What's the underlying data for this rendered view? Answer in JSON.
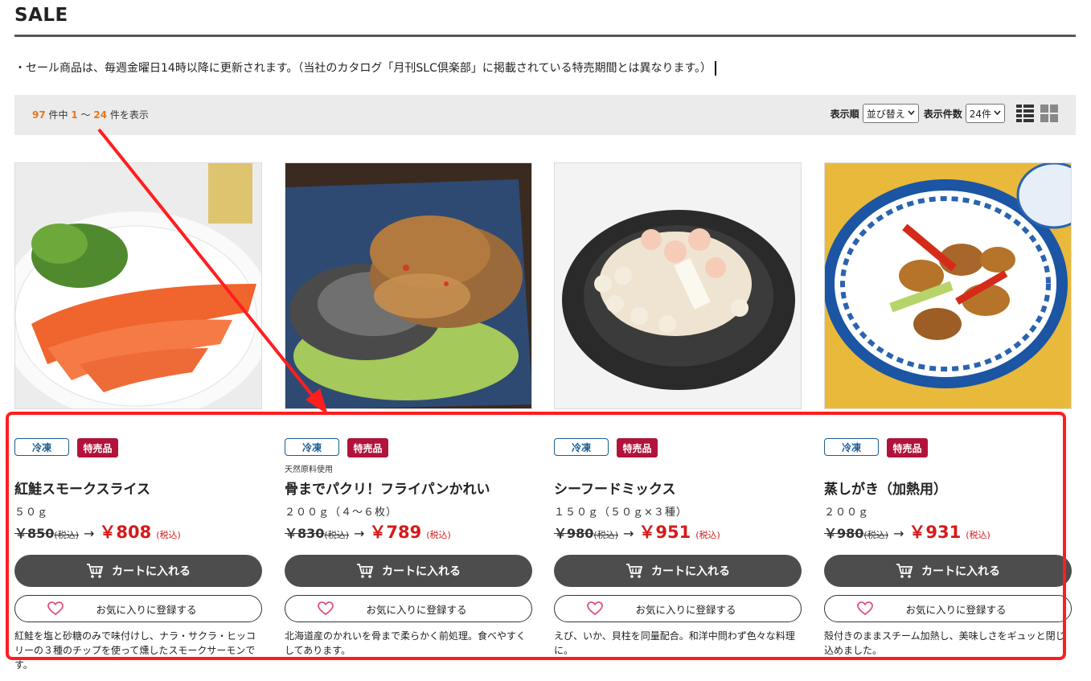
{
  "page": {
    "title": "SALE",
    "notice": "・セール商品は、毎週金曜日14時以降に更新されます。（当社のカタログ「月刊SLC倶楽部」に掲載されている特売期間とは異なります。）"
  },
  "toolbar": {
    "total": "97",
    "count_mid1": " 件中 ",
    "from": "1",
    "tilde": " ～ ",
    "to": "24",
    "count_tail": " 件を表示",
    "sort_label": "表示順",
    "sort_value": "並び替え",
    "perpage_label": "表示件数",
    "perpage_value": "24件"
  },
  "products": [
    {
      "badge_frozen": "冷凍",
      "badge_sale": "特売品",
      "tag": "",
      "name": "紅鮭スモークスライス",
      "spec": "５０ｇ",
      "old_price": "￥850",
      "old_tax": "(税込)",
      "arrow": "→",
      "new_price": "￥808",
      "new_tax": "(税込)",
      "cart_label": "カートに入れる",
      "fav_label": "お気に入りに登録する",
      "description": "紅鮭を塩と砂糖のみで味付けし、ナラ・サクラ・ヒッコリーの３種のチップを使って燻したスモークサーモンです。"
    },
    {
      "badge_frozen": "冷凍",
      "badge_sale": "特売品",
      "tag": "天然原料使用",
      "name": "骨までパクリ！フライパンかれい",
      "spec": "２００ｇ（４～６枚）",
      "old_price": "￥830",
      "old_tax": "(税込)",
      "arrow": "→",
      "new_price": "￥789",
      "new_tax": "(税込)",
      "cart_label": "カートに入れる",
      "fav_label": "お気に入りに登録する",
      "description": "北海道産のかれいを骨まで柔らかく前処理。食べやすくしてあります。"
    },
    {
      "badge_frozen": "冷凍",
      "badge_sale": "特売品",
      "tag": "",
      "name": "シーフードミックス",
      "spec": "１５０ｇ（５０ｇ×３種）",
      "old_price": "￥980",
      "old_tax": "(税込)",
      "arrow": "→",
      "new_price": "￥951",
      "new_tax": "(税込)",
      "cart_label": "カートに入れる",
      "fav_label": "お気に入りに登録する",
      "description": "えび、いか、貝柱を同量配合。和洋中問わず色々な料理に。"
    },
    {
      "badge_frozen": "冷凍",
      "badge_sale": "特売品",
      "tag": "",
      "name": "蒸しがき（加熱用）",
      "spec": "２００ｇ",
      "old_price": "￥980",
      "old_tax": "(税込)",
      "arrow": "→",
      "new_price": "￥931",
      "new_tax": "(税込)",
      "cart_label": "カートに入れる",
      "fav_label": "お気に入りに登録する",
      "description": "殻付きのままスチーム加熱し、美味しさをギュッと閉じ込めました。"
    }
  ],
  "colors": {
    "accent_orange": "#e8751a",
    "sale_badge": "#b1133a",
    "frozen_badge": "#1b5c93",
    "price_red": "#d61a1a",
    "annotation_red": "#ff1e1e"
  },
  "icons": [
    "cart-icon",
    "heart-icon",
    "list-view-icon",
    "grid-view-icon",
    "chevron-down-icon"
  ]
}
